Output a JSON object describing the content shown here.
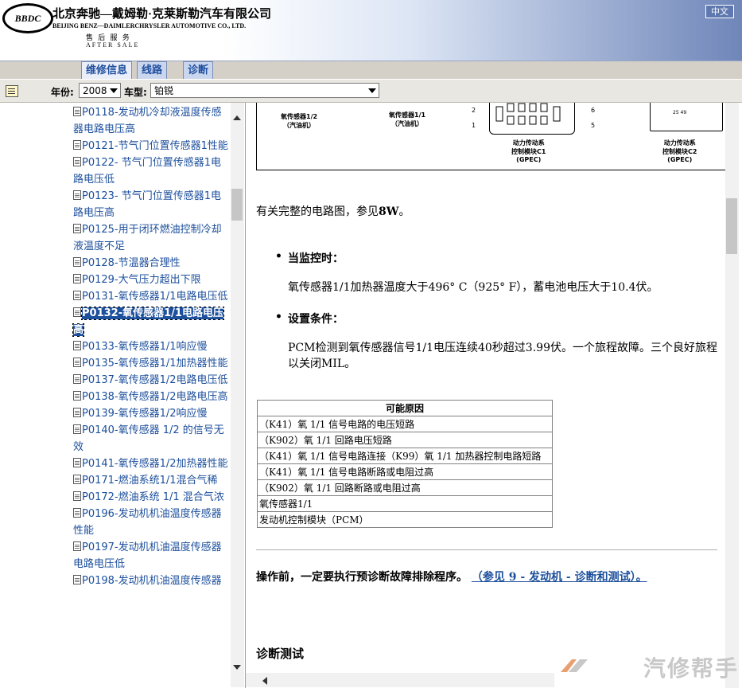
{
  "header": {
    "logo_text": "BBDC",
    "company_cn": "北京奔驰—戴姆勒·克莱斯勒汽车有限公司",
    "company_en": "BEIJING BENZ—DAIMLERCHRYSLER AUTOMOTIVE CO., LTD.",
    "after_sales_cn": "售 后 服 务",
    "after_sales_en": "AFTER SALE",
    "lang_button": "中文"
  },
  "tabs": [
    {
      "label": "维修信息",
      "active": true
    },
    {
      "label": "线路",
      "active": false
    },
    {
      "label": "诊断",
      "active": false
    }
  ],
  "toolbar": {
    "year_label": "年份:",
    "year_value": "2008",
    "model_label": "车型:",
    "model_value": "铂锐"
  },
  "tree": [
    {
      "text": "P0118-发动机冷却液温度传感器电路电压高"
    },
    {
      "text": "P0121-节气门位置传感器1性能"
    },
    {
      "text": "P0122- 节气门位置传感器1电路电压低"
    },
    {
      "text": "P0123- 节气门位置传感器1电路电压高"
    },
    {
      "text": "P0125-用于闭环燃油控制冷却液温度不足"
    },
    {
      "text": "P0128-节温器合理性"
    },
    {
      "text": "P0129-大气压力超出下限"
    },
    {
      "text": "P0131-氧传感器1/1电路电压低"
    },
    {
      "text": "P0132-氧传感器1/1电路电压高",
      "selected": true
    },
    {
      "text": "P0133-氧传感器1/1响应慢"
    },
    {
      "text": "P0135-氧传感器1/1加热器性能"
    },
    {
      "text": "P0137-氧传感器1/2电路电压低"
    },
    {
      "text": "P0138-氧传感器1/2电路电压高"
    },
    {
      "text": "P0139-氧传感器1/2响应慢"
    },
    {
      "text": "P0140-氧传感器 1/2 的信号无效"
    },
    {
      "text": "P0141-氧传感器1/2加热器性能"
    },
    {
      "text": "P0171-燃油系统1/1混合气稀"
    },
    {
      "text": "P0172-燃油系统 1/1 混合气浓"
    },
    {
      "text": "P0196-发动机机油温度传感器性能"
    },
    {
      "text": "P0197-发动机机油温度传感器电路电压低"
    },
    {
      "text": "P0198-发动机机油温度传感器"
    }
  ],
  "diagram": {
    "o2_12_l1": "氧传感器1/2",
    "o2_12_l2": "（汽油机）",
    "o2_11_l1": "氧传感器1/1",
    "o2_11_l2": "（汽油机）",
    "pin2": "2",
    "pin1": "1",
    "pin6": "6",
    "pin5": "5",
    "pcm_c1_l1": "动力传动系",
    "pcm_c1_l2": "控制模块C1",
    "pcm_c1_l3": "(GPEC)",
    "pcm_c2_l1": "动力传动系",
    "pcm_c2_l2": "控制模块C2",
    "pcm_c2_l3": "(GPEC)",
    "pin_small": "25   49"
  },
  "content": {
    "ref_prefix": "有关完整的电路图，参见",
    "ref_bold": "8W",
    "ref_suffix": "。",
    "monitor_heading": "当监控时：",
    "monitor_text": "氧传感器1/1加热器温度大于496° C（925° F），蓄电池电压大于10.4伏。",
    "set_heading": "设置条件：",
    "set_text": "PCM检测到氧传感器信号1/1电压连续40秒超过3.99伏。一个旅程故障。三个良好旅程以关闭MIL。",
    "causes_header": "可能原因",
    "causes": [
      "（K41）氧  1/1 信号电路的电压短路",
      "（K902）氧  1/1 回路电压短路",
      "（K41）氧  1/1 信号电路连接（K99）氧  1/1 加热器控制电路短路",
      "（K41）氧  1/1 信号电路断路或电阻过高",
      "（K902）氧  1/1 回路断路或电阻过高",
      "氧传感器1/1",
      "发动机控制模块（PCM）"
    ],
    "preop_text": "操作前，一定要执行预诊断故障排除程序。",
    "preop_link": "（参见  9 - 发动机  - 诊断和测试）。",
    "diag_test_heading": "诊断测试"
  },
  "watermark": "汽修帮手"
}
